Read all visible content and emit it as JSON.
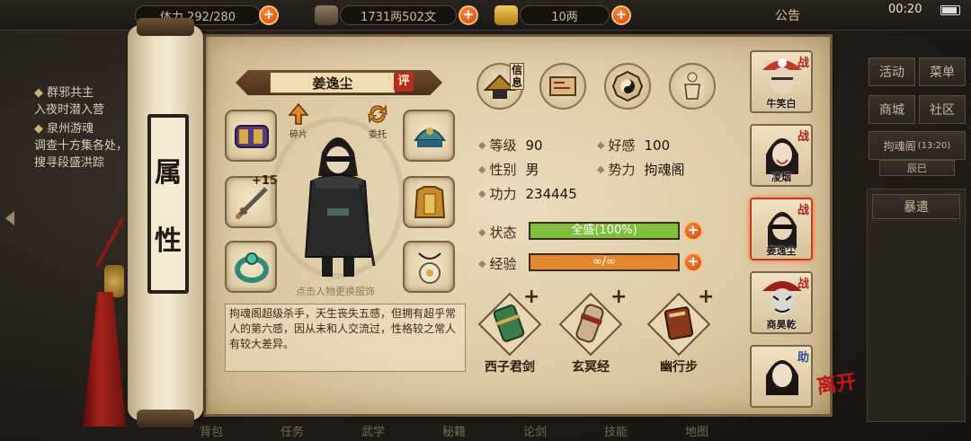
{
  "topbar": {
    "stamina": "体力 292/280",
    "money": "1731两502文",
    "gold": "10两",
    "announcement": "公告",
    "clock": "00:20"
  },
  "quests": [
    {
      "title": "群邪共主",
      "desc": "入夜时潜入营"
    },
    {
      "title": "泉州游魂",
      "desc": "调查十方集各处，搜寻段盛洪踪"
    }
  ],
  "right_menu": {
    "buttons": [
      "活动",
      "菜单",
      "商城",
      "社区"
    ],
    "location": "拘魂阁",
    "location_time": "(13:20)",
    "time_tag": "辰巳",
    "nav_label": "暴遣"
  },
  "bottom_dock": [
    "背包",
    "任务",
    "武学",
    "秘籍",
    "论剑",
    "技能",
    "地图"
  ],
  "scroll_tag": [
    "属",
    "性"
  ],
  "character": {
    "name": "姜逸尘",
    "rate_label": "评",
    "fragment_label": "碎片",
    "entrust_label": "委托",
    "change_outfit_hint": "点击人物更换服饰",
    "weapon_enhance": "+15",
    "description": "拘魂阁超级杀手，天生丧失五感，但拥有超乎常人的第六感，因从未和人交流过，性格较之常人有较大差异。"
  },
  "tabs": {
    "info_label": "信息"
  },
  "stats": {
    "level_label": "等级",
    "level": "90",
    "favor_label": "好感",
    "favor": "100",
    "gender_label": "性别",
    "gender": "男",
    "faction_label": "势力",
    "faction": "拘魂阁",
    "power_label": "功力",
    "power": "234445",
    "state_label": "状态",
    "state": "全盛(100%)",
    "state_fraction": 1.0,
    "exp_label": "经验",
    "exp": "∞/∞",
    "exp_fraction": 1.0
  },
  "skills": [
    {
      "name": "西子君剑"
    },
    {
      "name": "玄冥经"
    },
    {
      "name": "幽行步"
    }
  ],
  "party": [
    {
      "name": "牛笑白",
      "mark": "战"
    },
    {
      "name": "凌烟",
      "mark": "战"
    },
    {
      "name": "姜逸尘",
      "mark": "战"
    },
    {
      "name": "商昊乾",
      "mark": "战"
    },
    {
      "name": "",
      "mark": "助"
    }
  ],
  "leave_label": "离开",
  "colors": {
    "state_bar": "#7fbf3a",
    "exp_bar": "#e2892f",
    "accent_red": "#b62d1c"
  }
}
